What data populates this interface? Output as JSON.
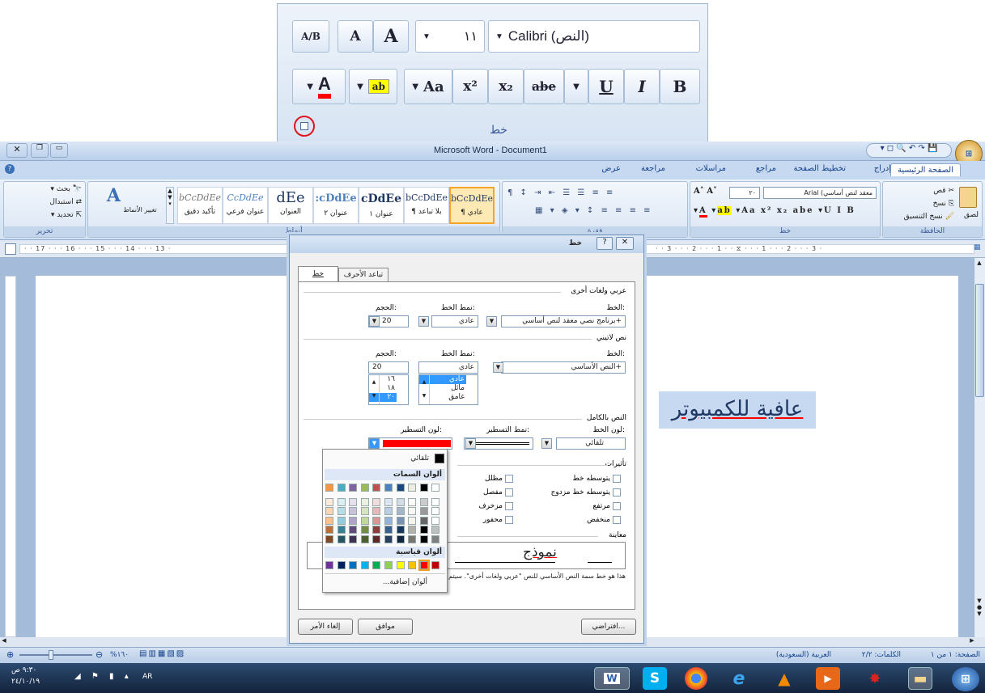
{
  "zoom_panel": {
    "font_name": "Calibri (النص)",
    "font_size": "١١",
    "group_label": "خط",
    "buttons": {
      "grow": "A",
      "shrink": "A",
      "clear_format": "A/B",
      "bold": "B",
      "italic": "I",
      "underline": "U",
      "strikethrough": "abe",
      "subscript": "x₂",
      "superscript": "x²",
      "change_case": "Aa",
      "highlight": "ab",
      "font_color": "A"
    }
  },
  "window": {
    "title": "Microsoft Word - Document1"
  },
  "ribbon": {
    "tabs": [
      "الصفحة الرئيسية",
      "إدراج",
      "تخطيط الصفحة",
      "مراجع",
      "مراسلات",
      "مراجعة",
      "عرض"
    ],
    "clipboard": {
      "label": "الحافظة",
      "paste": "لصق",
      "cut": "قص",
      "copy": "نسخ",
      "format_painter": "نسخ التنسيق"
    },
    "font_group": {
      "label": "خط",
      "font": "معقد لنص أساسي) Arial",
      "size": "٢٠"
    },
    "paragraph_group": {
      "label": "فقرة"
    },
    "styles": {
      "label": "أنماط",
      "items": [
        {
          "sample": "bCcDdEe",
          "name": "¶ عادي"
        },
        {
          "sample": "bCcDdEe",
          "name": "¶ بلا تباعد"
        },
        {
          "sample": "cDdEe",
          "name": "عنوان ١"
        },
        {
          "sample": ":cDdEe",
          "name": "عنوان ٢"
        },
        {
          "sample": "dEe",
          "name": "العنوان"
        },
        {
          "sample": "CcDdEe",
          "name": "عنوان فرعي"
        },
        {
          "sample": "bCcDdEe",
          "name": "تأكيد دقيق"
        }
      ],
      "change": "تغيير الأنماط"
    },
    "editing": {
      "label": "تحرير",
      "find": "بحث",
      "replace": "استبدال",
      "select": "تحديد"
    }
  },
  "ruler": {
    "numbers": [
      "17",
      "16",
      "15",
      "14",
      "13",
      "3",
      "2",
      "1",
      "1",
      "2",
      "3"
    ]
  },
  "document": {
    "text": "عافية للكمبيوتر"
  },
  "dialog": {
    "title": "خط",
    "tabs": [
      "خط",
      "تباعد الأحرف"
    ],
    "complex": {
      "section": "عربي ولغات أخرى",
      "font_label": "الخط:",
      "font": "+برنامج نصي معقد لنص أساسي",
      "style_label": "نمط الخط:",
      "style": "عادي",
      "size_label": "الحجم:",
      "size": "20"
    },
    "latin": {
      "section": "نص لاتيني",
      "font_label": "الخط:",
      "font": "+النص الأساسي",
      "style_label": "نمط الخط:",
      "style": "عادي",
      "style_list": [
        "عادي",
        "مائل",
        "غامق"
      ],
      "size_label": "الحجم:",
      "size": "20",
      "size_list": [
        "١٦",
        "١٨",
        "٢٠"
      ]
    },
    "complete": {
      "section": "النص بالكامل",
      "color_label": "لون الخط:",
      "color": "تلقائي",
      "underline_label": "نمط التسطير:",
      "underline_color_label": "لون التسطير:"
    },
    "effects": {
      "section": "تأثيرات",
      "items": [
        "يتوسطه خط",
        "يتوسطه خط مزدوج",
        "مرتفع",
        "منخفض",
        "مظلل",
        "مفصل",
        "مزخرف",
        "محفور"
      ]
    },
    "preview": {
      "section": "معاينة",
      "sample": "نموذج",
      "description": "هذا هو خط سمة النص الأساسي للنص \"عربي ولغات أخرى\". سيتم تحديد الخط الذي سيتم استخدامه."
    },
    "buttons": {
      "default": "افتراضي...",
      "ok": "موافق",
      "cancel": "إلغاء الأمر"
    }
  },
  "color_popup": {
    "automatic": "تلقائي",
    "theme_label": "ألوان السمات",
    "standard_label": "ألوان قياسية",
    "more": "ألوان إضافية...",
    "theme_top": [
      "#ffffff",
      "#000000",
      "#eeece1",
      "#1f497d",
      "#4f81bd",
      "#c0504d",
      "#9bbb59",
      "#8064a2",
      "#4bacc6",
      "#f79646"
    ],
    "standard": [
      "#c00000",
      "#ff0000",
      "#ffc000",
      "#ffff00",
      "#92d050",
      "#00b050",
      "#00b0f0",
      "#0070c0",
      "#002060",
      "#7030a0"
    ]
  },
  "statusbar": {
    "page": "الصفحة: ١ من ١",
    "words": "الكلمات: ٢/٢",
    "language": "العربية (السعودية)",
    "zoom": "%١٦٠"
  },
  "taskbar": {
    "time": "٩:٣٠ ص",
    "date": "٢٤/١٠/١٩",
    "lang": "AR"
  },
  "colors": {
    "underline_color": "#ff0000",
    "accent": "#15428b",
    "selection": "#c6d9f1"
  }
}
